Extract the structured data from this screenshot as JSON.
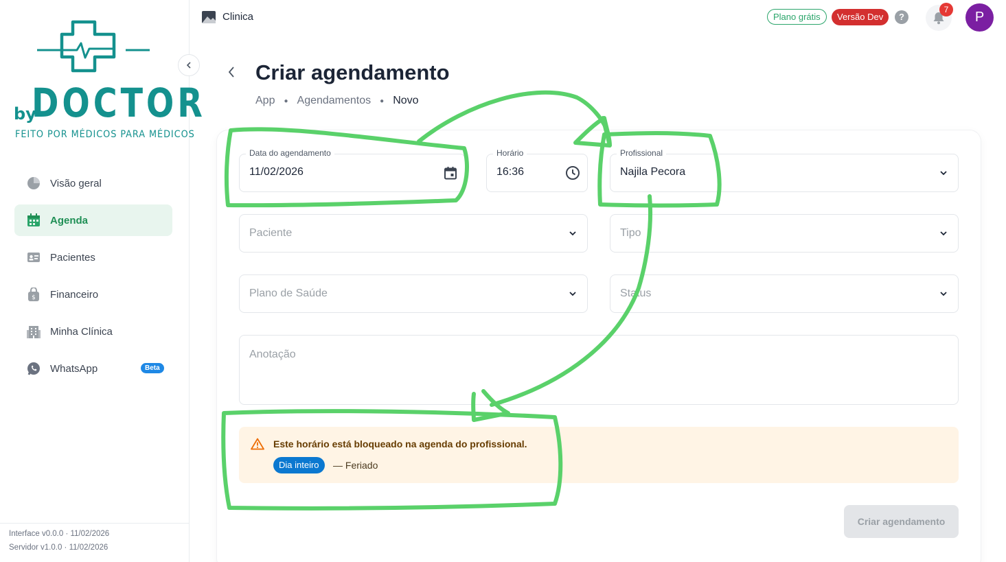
{
  "brand": {
    "by": "by",
    "name": "DOCTOR",
    "tagline": "FEITO POR MÉDICOS PARA MÉDICOS"
  },
  "sidebar": {
    "items": [
      {
        "label": "Visão geral",
        "icon": "pie-chart-icon",
        "active": false
      },
      {
        "label": "Agenda",
        "icon": "calendar-icon",
        "active": true
      },
      {
        "label": "Pacientes",
        "icon": "id-card-icon",
        "active": false
      },
      {
        "label": "Financeiro",
        "icon": "money-bag-icon",
        "active": false
      },
      {
        "label": "Minha Clínica",
        "icon": "building-icon",
        "active": false
      },
      {
        "label": "WhatsApp",
        "icon": "whatsapp-icon",
        "active": false,
        "badge": "Beta"
      }
    ],
    "versions": {
      "interface": "Interface v0.0.0 · 11/02/2026",
      "server": "Servidor v1.0.0 · 11/02/2026"
    }
  },
  "topbar": {
    "title": "Clinica",
    "plan_badge": "Plano grátis",
    "dev_badge": "Versão Dev",
    "help": "?",
    "notifications": "7",
    "avatar_initial": "P"
  },
  "header": {
    "title": "Criar agendamento",
    "breadcrumb": [
      "App",
      "Agendamentos",
      "Novo"
    ]
  },
  "form": {
    "date": {
      "label": "Data do agendamento",
      "value": "11/02/2026"
    },
    "time": {
      "label": "Horário",
      "value": "16:36"
    },
    "professional": {
      "label": "Profissional",
      "value": "Najila Pecora"
    },
    "patient": {
      "placeholder": "Paciente"
    },
    "type": {
      "placeholder": "Tipo"
    },
    "plan": {
      "placeholder": "Plano de Saúde"
    },
    "status": {
      "placeholder": "Status"
    },
    "note": {
      "placeholder": "Anotação"
    }
  },
  "alert": {
    "message": "Este horário está bloqueado na agenda do profissional.",
    "chip": "Dia inteiro",
    "reason": "— Feriado"
  },
  "submit_label": "Criar agendamento",
  "colors": {
    "brand": "#14918e",
    "active_nav_bg": "#e8f5ee",
    "active_nav_text": "#1f8f55",
    "annotation": "#5ad16a",
    "alert_bg": "#fff4e5",
    "chip": "#0b78d0",
    "dev_badge": "#d32f2f",
    "avatar": "#7b1fa2"
  }
}
